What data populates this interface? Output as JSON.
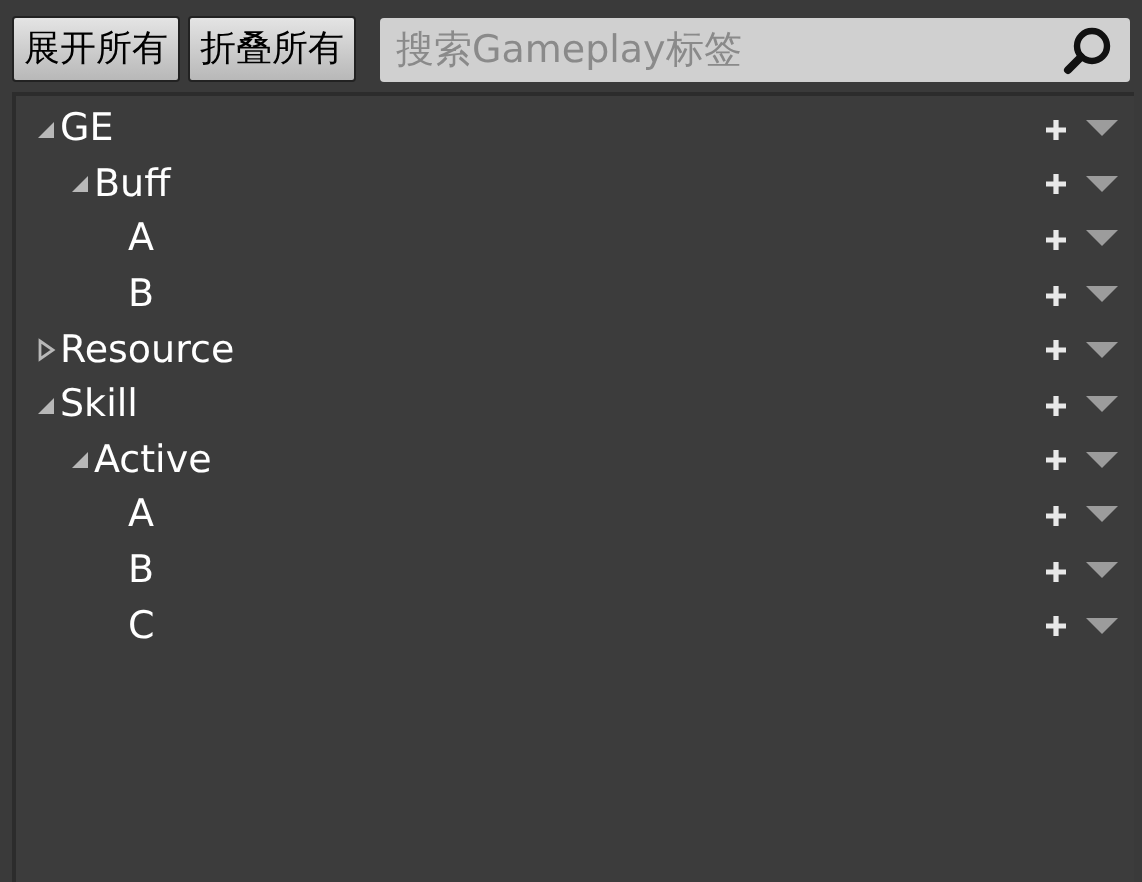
{
  "toolbar": {
    "buttons": [
      "展开所有",
      "折叠所有"
    ],
    "search": {
      "placeholder": "搜索Gameplay标签"
    }
  },
  "tree": [
    {
      "label": "GE",
      "expanded": true,
      "children": [
        {
          "label": "Buff",
          "expanded": true,
          "children": [
            {
              "label": "A"
            },
            {
              "label": "B"
            }
          ]
        }
      ]
    },
    {
      "label": "Resource",
      "expanded": false
    },
    {
      "label": "Skill",
      "expanded": true,
      "children": [
        {
          "label": "Active",
          "expanded": true,
          "children": [
            {
              "label": "A"
            },
            {
              "label": "B"
            },
            {
              "label": "C"
            }
          ]
        }
      ]
    }
  ]
}
